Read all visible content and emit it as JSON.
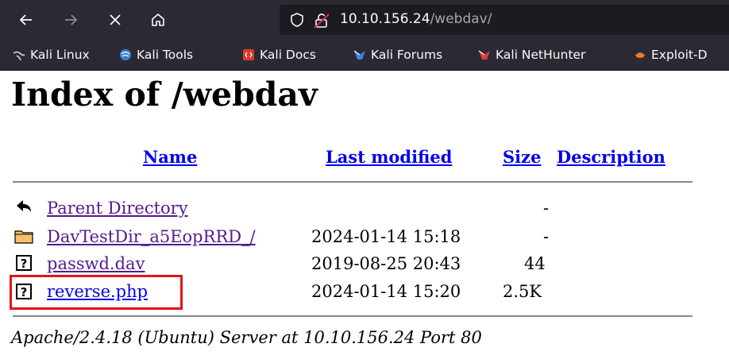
{
  "browser": {
    "url_host": "10.10.156.24",
    "url_path": "/webdav/",
    "bookmarks": [
      {
        "label": "Kali Linux",
        "icon": "kali-dragon-icon"
      },
      {
        "label": "Kali Tools",
        "icon": "kali-tools-icon"
      },
      {
        "label": "Kali Docs",
        "icon": "kali-docs-icon"
      },
      {
        "label": "Kali Forums",
        "icon": "kali-forums-icon"
      },
      {
        "label": "Kali NetHunter",
        "icon": "kali-nethunter-icon"
      },
      {
        "label": "Exploit-D",
        "icon": "exploit-db-icon"
      }
    ]
  },
  "page": {
    "title": "Index of /webdav",
    "columns": {
      "name": "Name",
      "last_modified": "Last modified",
      "size": "Size",
      "description": "Description"
    },
    "rows": [
      {
        "name": "Parent Directory",
        "modified": "",
        "size": "-",
        "icon": "back-arrow-icon"
      },
      {
        "name": "DavTestDir_a5EopRRD_/",
        "modified": "2024-01-14 15:18",
        "size": "-",
        "icon": "folder-icon"
      },
      {
        "name": "passwd.dav",
        "modified": "2019-08-25 20:43",
        "size": "44",
        "icon": "unknown-file-icon"
      },
      {
        "name": "reverse.php",
        "modified": "2024-01-14 15:20",
        "size": "2.5K",
        "icon": "unknown-file-icon"
      }
    ],
    "address": "Apache/2.4.18 (Ubuntu) Server at 10.10.156.24 Port 80"
  },
  "colors": {
    "chrome_bg": "#2b2a33",
    "urlbar_bg": "#1c1b22",
    "link": "#0000ee",
    "visited_link": "#551a8b",
    "highlight_box": "#e0151b"
  }
}
